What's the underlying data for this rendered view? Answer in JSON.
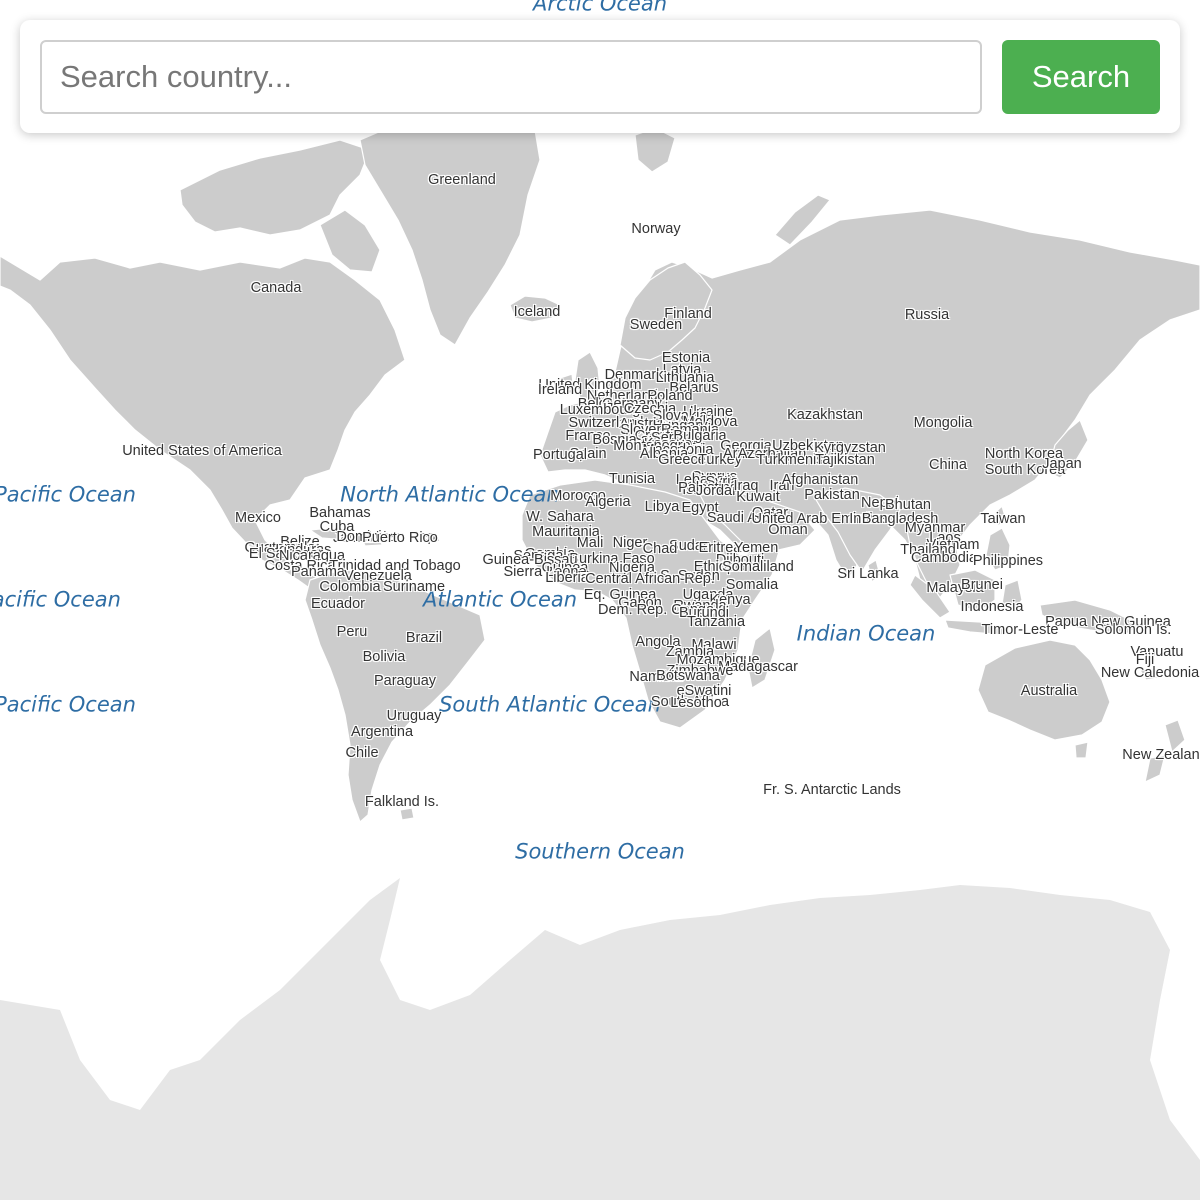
{
  "search": {
    "placeholder": "Search country...",
    "value": "",
    "button_label": "Search"
  },
  "colors": {
    "land": "#cccccc",
    "antarctica": "#e6e6e6",
    "ocean_label": "#2e6da4",
    "country_label": "#333333",
    "search_button": "#4caf50"
  },
  "oceans": [
    {
      "id": "arctic",
      "name": "Arctic Ocean"
    },
    {
      "id": "pacific-north",
      "name": "Pacific Ocean"
    },
    {
      "id": "north-atlantic",
      "name": "North Atlantic Ocean"
    },
    {
      "id": "pacific-mid",
      "name": "Pacific Ocean"
    },
    {
      "id": "atlantic",
      "name": "Atlantic Ocean"
    },
    {
      "id": "indian",
      "name": "Indian Ocean"
    },
    {
      "id": "pacific-south",
      "name": "Pacific Ocean"
    },
    {
      "id": "south-atlantic",
      "name": "South Atlantic Ocean"
    },
    {
      "id": "southern",
      "name": "Southern Ocean"
    }
  ],
  "countries": [
    {
      "id": "greenland",
      "name": "Greenland"
    },
    {
      "id": "norway",
      "name": "Norway"
    },
    {
      "id": "canada",
      "name": "Canada"
    },
    {
      "id": "iceland",
      "name": "Iceland"
    },
    {
      "id": "finland",
      "name": "Finland"
    },
    {
      "id": "sweden",
      "name": "Sweden"
    },
    {
      "id": "russia",
      "name": "Russia"
    },
    {
      "id": "estonia",
      "name": "Estonia"
    },
    {
      "id": "latvia",
      "name": "Latvia"
    },
    {
      "id": "denmark",
      "name": "Denmark"
    },
    {
      "id": "lithuania",
      "name": "Lithuania"
    },
    {
      "id": "united-kingdom",
      "name": "United Kingdom"
    },
    {
      "id": "belarus",
      "name": "Belarus"
    },
    {
      "id": "ireland",
      "name": "Ireland"
    },
    {
      "id": "netherlands",
      "name": "Netherlands"
    },
    {
      "id": "poland",
      "name": "Poland"
    },
    {
      "id": "belgium",
      "name": "Belgium"
    },
    {
      "id": "germany",
      "name": "Germany"
    },
    {
      "id": "luxembourg",
      "name": "Luxembourg"
    },
    {
      "id": "czechia",
      "name": "Czechia"
    },
    {
      "id": "ukraine",
      "name": "Ukraine"
    },
    {
      "id": "slovakia",
      "name": "Slovakia"
    },
    {
      "id": "moldova",
      "name": "Moldova"
    },
    {
      "id": "switzerland",
      "name": "Switzerland"
    },
    {
      "id": "austria",
      "name": "Austria"
    },
    {
      "id": "hungary",
      "name": "Hungary"
    },
    {
      "id": "slovenia",
      "name": "Slovenia"
    },
    {
      "id": "romania",
      "name": "Romania"
    },
    {
      "id": "france",
      "name": "France"
    },
    {
      "id": "croatia",
      "name": "Croatia"
    },
    {
      "id": "bosnia",
      "name": "Bosnia and Herz."
    },
    {
      "id": "serbia",
      "name": "Serbia"
    },
    {
      "id": "bulgaria",
      "name": "Bulgaria"
    },
    {
      "id": "kosovo",
      "name": "Kosovo"
    },
    {
      "id": "montenegro",
      "name": "Montenegro"
    },
    {
      "id": "macedonia",
      "name": "Macedonia"
    },
    {
      "id": "albania",
      "name": "Albania"
    },
    {
      "id": "greece",
      "name": "Greece"
    },
    {
      "id": "turkey",
      "name": "Turkey"
    },
    {
      "id": "georgia",
      "name": "Georgia"
    },
    {
      "id": "armenia",
      "name": "Armenia"
    },
    {
      "id": "azerbaijan",
      "name": "Azerbaijan"
    },
    {
      "id": "kazakhstan",
      "name": "Kazakhstan"
    },
    {
      "id": "mongolia",
      "name": "Mongolia"
    },
    {
      "id": "uzbekistan",
      "name": "Uzbekistan"
    },
    {
      "id": "kyrgyzstan",
      "name": "Kyrgyzstan"
    },
    {
      "id": "turkmenistan",
      "name": "Turkmenistan"
    },
    {
      "id": "tajikistan",
      "name": "Tajikistan"
    },
    {
      "id": "spain",
      "name": "Spain"
    },
    {
      "id": "portugal",
      "name": "Portugal"
    },
    {
      "id": "china",
      "name": "China"
    },
    {
      "id": "north-korea",
      "name": "North Korea"
    },
    {
      "id": "south-korea",
      "name": "South Korea"
    },
    {
      "id": "japan",
      "name": "Japan"
    },
    {
      "id": "united-states",
      "name": "United States of America"
    },
    {
      "id": "tunisia",
      "name": "Tunisia"
    },
    {
      "id": "cyprus",
      "name": "Cyprus"
    },
    {
      "id": "lebanon",
      "name": "Lebanon"
    },
    {
      "id": "syria",
      "name": "Syria"
    },
    {
      "id": "israel",
      "name": "Israel"
    },
    {
      "id": "palestine",
      "name": "Palestine"
    },
    {
      "id": "jordan",
      "name": "Jordan"
    },
    {
      "id": "iraq",
      "name": "Iraq"
    },
    {
      "id": "iran",
      "name": "Iran"
    },
    {
      "id": "afghanistan",
      "name": "Afghanistan"
    },
    {
      "id": "morocco",
      "name": "Morocco"
    },
    {
      "id": "algeria",
      "name": "Algeria"
    },
    {
      "id": "libya",
      "name": "Libya"
    },
    {
      "id": "egypt",
      "name": "Egypt"
    },
    {
      "id": "kuwait",
      "name": "Kuwait"
    },
    {
      "id": "pakistan",
      "name": "Pakistan"
    },
    {
      "id": "nepal",
      "name": "Nepal"
    },
    {
      "id": "bhutan",
      "name": "Bhutan"
    },
    {
      "id": "bahamas",
      "name": "Bahamas"
    },
    {
      "id": "mexico",
      "name": "Mexico"
    },
    {
      "id": "w-sahara",
      "name": "W. Sahara"
    },
    {
      "id": "saudi-arabia",
      "name": "Saudi Arabia"
    },
    {
      "id": "qatar",
      "name": "Qatar"
    },
    {
      "id": "uae",
      "name": "United Arab Emirates"
    },
    {
      "id": "india",
      "name": "India"
    },
    {
      "id": "bangladesh",
      "name": "Bangladesh"
    },
    {
      "id": "taiwan",
      "name": "Taiwan"
    },
    {
      "id": "cuba",
      "name": "Cuba"
    },
    {
      "id": "mauritania",
      "name": "Mauritania"
    },
    {
      "id": "oman",
      "name": "Oman"
    },
    {
      "id": "myanmar",
      "name": "Myanmar"
    },
    {
      "id": "belize",
      "name": "Belize"
    },
    {
      "id": "jamaica",
      "name": "Jamaica"
    },
    {
      "id": "haiti",
      "name": "Haiti"
    },
    {
      "id": "dominican-rep",
      "name": "Dominican Rep."
    },
    {
      "id": "puerto-rico",
      "name": "Puerto Rico"
    },
    {
      "id": "mali",
      "name": "Mali"
    },
    {
      "id": "niger",
      "name": "Niger"
    },
    {
      "id": "sudan",
      "name": "Sudan"
    },
    {
      "id": "eritrea",
      "name": "Eritrea"
    },
    {
      "id": "yemen",
      "name": "Yemen"
    },
    {
      "id": "laos",
      "name": "Laos"
    },
    {
      "id": "vietnam",
      "name": "Vietnam"
    },
    {
      "id": "guatemala",
      "name": "Guatemala"
    },
    {
      "id": "honduras",
      "name": "Honduras"
    },
    {
      "id": "el-salvador",
      "name": "El Salvador"
    },
    {
      "id": "nicaragua",
      "name": "Nicaragua"
    },
    {
      "id": "chad",
      "name": "Chad"
    },
    {
      "id": "thailand",
      "name": "Thailand"
    },
    {
      "id": "gambia",
      "name": "Gambia"
    },
    {
      "id": "senegal",
      "name": "Senegal"
    },
    {
      "id": "burkina-faso",
      "name": "Burkina Faso"
    },
    {
      "id": "djibouti",
      "name": "Djibouti"
    },
    {
      "id": "cambodia",
      "name": "Cambodia"
    },
    {
      "id": "philippines",
      "name": "Philippines"
    },
    {
      "id": "costa-rica",
      "name": "Costa Rica"
    },
    {
      "id": "trinidad",
      "name": "Trinidad and Tobago"
    },
    {
      "id": "guinea-bissau",
      "name": "Guinea-Bissau"
    },
    {
      "id": "guinea-w",
      "name": "Guinea"
    },
    {
      "id": "nigeria",
      "name": "Nigeria"
    },
    {
      "id": "ethiopia",
      "name": "Ethiopia"
    },
    {
      "id": "somaliland",
      "name": "Somaliland"
    },
    {
      "id": "panama",
      "name": "Panama"
    },
    {
      "id": "venezuela",
      "name": "Venezuela"
    },
    {
      "id": "sierra-leone",
      "name": "Sierra Leone"
    },
    {
      "id": "s-sudan",
      "name": "S. Sudan"
    },
    {
      "id": "sri-lanka",
      "name": "Sri Lanka"
    },
    {
      "id": "colombia",
      "name": "Colombia"
    },
    {
      "id": "suriname",
      "name": "Suriname"
    },
    {
      "id": "liberia",
      "name": "Liberia"
    },
    {
      "id": "central-african",
      "name": "Central African Rep."
    },
    {
      "id": "somalia",
      "name": "Somalia"
    },
    {
      "id": "malaysia",
      "name": "Malaysia"
    },
    {
      "id": "brunei",
      "name": "Brunei"
    },
    {
      "id": "ecuador",
      "name": "Ecuador"
    },
    {
      "id": "eq-guinea",
      "name": "Eq. Guinea"
    },
    {
      "id": "uganda",
      "name": "Uganda"
    },
    {
      "id": "kenya",
      "name": "Kenya"
    },
    {
      "id": "gabon",
      "name": "Gabon"
    },
    {
      "id": "rwanda",
      "name": "Rwanda"
    },
    {
      "id": "dem-rep-congo",
      "name": "Dem. Rep. Congo"
    },
    {
      "id": "burundi",
      "name": "Burundi"
    },
    {
      "id": "indonesia",
      "name": "Indonesia"
    },
    {
      "id": "tanzania",
      "name": "Tanzania"
    },
    {
      "id": "papua-new-guinea",
      "name": "Papua New Guinea"
    },
    {
      "id": "solomon-is",
      "name": "Solomon Is."
    },
    {
      "id": "timor-leste",
      "name": "Timor-Leste"
    },
    {
      "id": "peru",
      "name": "Peru"
    },
    {
      "id": "brazil",
      "name": "Brazil"
    },
    {
      "id": "angola",
      "name": "Angola"
    },
    {
      "id": "malawi",
      "name": "Malawi"
    },
    {
      "id": "zambia",
      "name": "Zambia"
    },
    {
      "id": "mozambique",
      "name": "Mozambique"
    },
    {
      "id": "bolivia",
      "name": "Bolivia"
    },
    {
      "id": "vanuatu",
      "name": "Vanuatu"
    },
    {
      "id": "fiji",
      "name": "Fiji"
    },
    {
      "id": "madagascar",
      "name": "Madagascar"
    },
    {
      "id": "zimbabwe",
      "name": "Zimbabwe"
    },
    {
      "id": "new-caledonia",
      "name": "New Caledonia"
    },
    {
      "id": "namibia",
      "name": "Namibia"
    },
    {
      "id": "botswana",
      "name": "Botswana"
    },
    {
      "id": "paraguay",
      "name": "Paraguay"
    },
    {
      "id": "australia",
      "name": "Australia"
    },
    {
      "id": "eswatini",
      "name": "eSwatini"
    },
    {
      "id": "south-africa",
      "name": "South Africa"
    },
    {
      "id": "lesotho",
      "name": "Lesotho"
    },
    {
      "id": "uruguay",
      "name": "Uruguay"
    },
    {
      "id": "argentina",
      "name": "Argentina"
    },
    {
      "id": "chile",
      "name": "Chile"
    },
    {
      "id": "new-zealand",
      "name": "New Zealand"
    },
    {
      "id": "fr-s-antarctic",
      "name": "Fr. S. Antarctic Lands"
    },
    {
      "id": "falkland",
      "name": "Falkland Is."
    }
  ]
}
